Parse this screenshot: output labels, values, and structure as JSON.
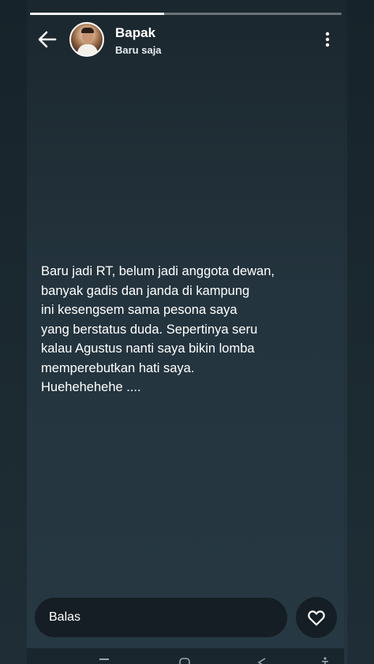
{
  "story": {
    "progress_fraction": 0.43
  },
  "header": {
    "name": "Bapak",
    "time": "Baru saja"
  },
  "message": {
    "text": "Baru jadi RT, belum jadi anggota dewan,\nbanyak gadis dan janda di kampung\nini kesengsem sama pesona saya\nyang berstatus duda. Sepertinya seru\nkalau Agustus nanti saya bikin lomba\nmemperebutkan hati saya.\nHuehehehehe ...."
  },
  "reply": {
    "placeholder": "Balas"
  },
  "icons": {
    "back": "arrow-left-icon",
    "menu": "vertical-dots-icon",
    "like": "heart-outline-icon",
    "nav_recent": "recent-apps-icon",
    "nav_home": "home-icon",
    "nav_back": "triangle-back-icon",
    "nav_accessibility": "accessibility-icon"
  },
  "colors": {
    "background": "#22323b",
    "text": "#ffffff",
    "input_bg": "#141e24"
  }
}
